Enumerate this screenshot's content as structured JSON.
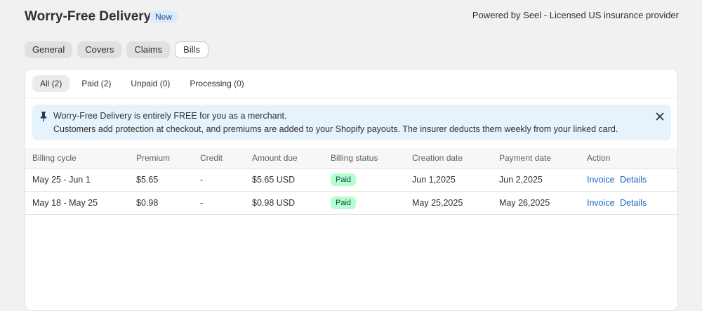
{
  "header": {
    "title": "Worry-Free Delivery",
    "badge": "New",
    "powered_by": "Powered by Seel - Licensed US insurance provider"
  },
  "tabs": [
    "General",
    "Covers",
    "Claims",
    "Bills"
  ],
  "active_tab": "Bills",
  "subtabs": [
    "All (2)",
    "Paid (2)",
    "Unpaid (0)",
    "Processing (0)"
  ],
  "active_subtab": "All (2)",
  "banner": {
    "line1": "Worry-Free Delivery is entirely FREE for you as a merchant.",
    "line2": "Customers add protection at checkout, and premiums are added to your Shopify payouts. The insurer deducts them weekly from your linked card.",
    "icon": "pin-icon",
    "close_icon": "close-icon"
  },
  "table": {
    "columns": [
      "Billing cycle",
      "Premium",
      "Credit",
      "Amount due",
      "Billing status",
      "Creation date",
      "Payment date",
      "Action"
    ],
    "rows": [
      {
        "cycle": "May 25 - Jun 1",
        "premium": "$5.65",
        "credit": "-",
        "amount": "$5.65 USD",
        "status": "Paid",
        "created": "Jun 1,2025",
        "paid": "Jun 2,2025",
        "action1": "Invoice",
        "action2": "Details"
      },
      {
        "cycle": "May 18 - May 25",
        "premium": "$0.98",
        "credit": "-",
        "amount": "$0.98 USD",
        "status": "Paid",
        "created": "May 25,2025",
        "paid": "May 26,2025",
        "action1": "Invoice",
        "action2": "Details"
      }
    ]
  },
  "colors": {
    "accent_link": "#1a62c7",
    "banner_bg": "#e6f3fc",
    "paid_badge": "#b4fed2"
  }
}
